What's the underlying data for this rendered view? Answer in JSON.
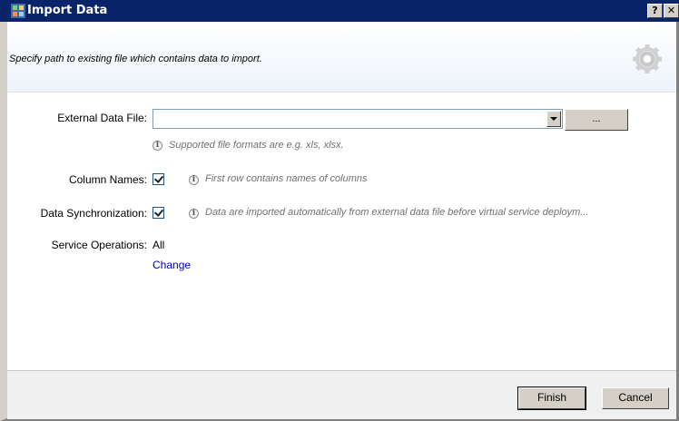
{
  "window": {
    "title": "Import Data",
    "help_label": "?",
    "close_label": "✕"
  },
  "header": {
    "description": "Specify path to existing file which contains data to import."
  },
  "form": {
    "external_file": {
      "label": "External Data File:",
      "value": "",
      "browse_label": "...",
      "hint": "Supported file formats are e.g. xls, xlsx."
    },
    "column_names": {
      "label": "Column Names:",
      "checked": true,
      "hint": "First row contains names of columns"
    },
    "data_sync": {
      "label": "Data Synchronization:",
      "checked": true,
      "hint": "Data are imported automatically from external data file before virtual service deploym..."
    },
    "service_operations": {
      "label": "Service Operations:",
      "value": "All",
      "change_link": "Change"
    }
  },
  "footer": {
    "finish_label": "Finish",
    "cancel_label": "Cancel"
  },
  "icons": {
    "info": "info-icon",
    "gear": "gear-icon",
    "app": "app-icon"
  },
  "colors": {
    "titlebar": "#0a246a",
    "link": "#0000cc",
    "hint": "#707070"
  }
}
